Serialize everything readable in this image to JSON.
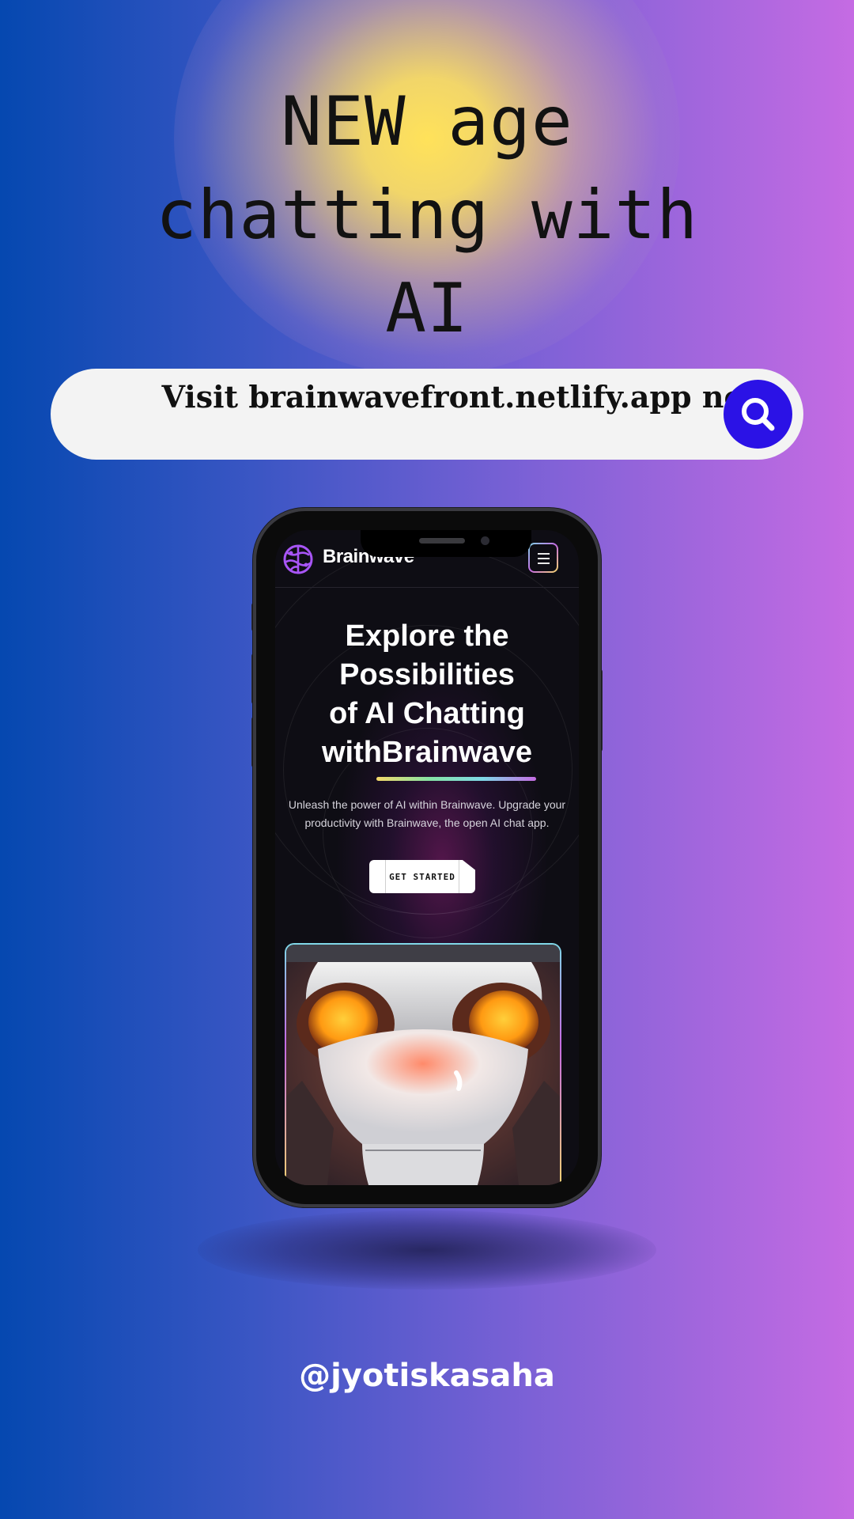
{
  "poster": {
    "headline_lines": [
      "NEW age",
      "chatting with",
      "AI"
    ],
    "search_bar_text": "Visit brainwavefront.netlify.app now",
    "search_icon": "search-icon",
    "handle": "@jyotiskasaha"
  },
  "app": {
    "brand": "Brainwave",
    "logo_icon": "brain-icon",
    "menu_icon": "hamburger-menu-icon",
    "hero": {
      "title_lines": [
        "Explore the",
        "Possibilities",
        "of AI Chatting",
        "withBrainwave"
      ],
      "description": "Unleash the power of AI within Brainwave. Upgrade your productivity with Brainwave, the open AI chat app.",
      "cta_label": "GET STARTED"
    },
    "image_subject": "robot-face-illustration"
  },
  "colors": {
    "accent_blue": "#2b12e6",
    "brand_purple": "#a855f7",
    "gradient_left": "#0548b0",
    "gradient_right": "#c56be3",
    "glow_yellow": "#ffe25a"
  }
}
